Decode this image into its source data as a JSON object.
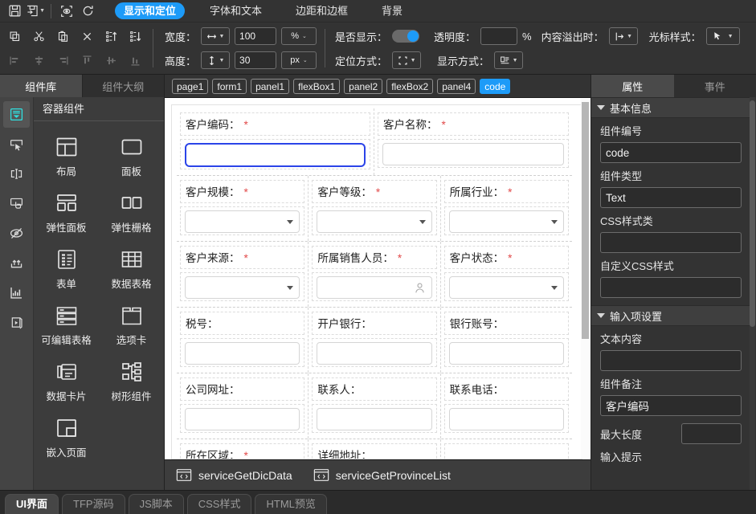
{
  "toolbar": {
    "file_actions": [
      {
        "name": "save-icon",
        "title": "保存"
      },
      {
        "name": "save-as-icon",
        "title": "另存为"
      },
      {
        "name": "preview-icon",
        "title": "预览"
      },
      {
        "name": "refresh-icon",
        "title": "刷新"
      }
    ],
    "category_tabs": [
      {
        "label": "显示和定位",
        "active": true
      },
      {
        "label": "字体和文本",
        "active": false
      },
      {
        "label": "边距和边框",
        "active": false
      },
      {
        "label": "背景",
        "active": false
      }
    ],
    "edit_actions": [
      {
        "name": "copy-icon",
        "disabled": false
      },
      {
        "name": "cut-icon",
        "disabled": false
      },
      {
        "name": "paste-icon",
        "disabled": false
      },
      {
        "name": "delete-icon",
        "disabled": false
      },
      {
        "name": "move-up-icon",
        "disabled": false
      },
      {
        "name": "move-down-icon",
        "disabled": false
      }
    ],
    "align_actions": [
      {
        "name": "align-left-icon",
        "disabled": true
      },
      {
        "name": "align-center-h-icon",
        "disabled": true
      },
      {
        "name": "align-right-icon",
        "disabled": true
      },
      {
        "name": "align-top-icon",
        "disabled": true
      },
      {
        "name": "align-middle-v-icon",
        "disabled": true
      },
      {
        "name": "align-bottom-icon",
        "disabled": true
      }
    ],
    "width_label": "宽度：",
    "width_value": "100",
    "width_unit": "%",
    "height_label": "高度：",
    "height_value": "30",
    "height_unit": "px",
    "visible_label": "是否显示：",
    "visible_on": true,
    "opacity_label": "透明度：",
    "opacity_value": "",
    "opacity_unit": "%",
    "overflow_label": "内容溢出时：",
    "cursor_label": "光标样式：",
    "position_label": "定位方式：",
    "display_label": "显示方式："
  },
  "left_panel": {
    "tabs": [
      {
        "label": "组件库",
        "active": true
      },
      {
        "label": "组件大纲",
        "active": false
      }
    ],
    "rail": [
      {
        "name": "container-icon",
        "active": true
      },
      {
        "name": "selection-icon",
        "active": false
      },
      {
        "name": "input-icon",
        "active": false
      },
      {
        "name": "button-icon",
        "active": false
      },
      {
        "name": "hidden-icon",
        "active": false
      },
      {
        "name": "upload-icon",
        "active": false
      },
      {
        "name": "chart-icon",
        "active": false
      },
      {
        "name": "media-icon",
        "active": false
      }
    ],
    "group_title": "容器组件",
    "components": [
      {
        "label": "布局",
        "icon": "layout-icon"
      },
      {
        "label": "面板",
        "icon": "panel-icon"
      },
      {
        "label": "弹性面板",
        "icon": "flex-panel-icon"
      },
      {
        "label": "弹性栅格",
        "icon": "flex-grid-icon"
      },
      {
        "label": "表单",
        "icon": "form-icon"
      },
      {
        "label": "数据表格",
        "icon": "data-table-icon"
      },
      {
        "label": "可编辑表格",
        "icon": "editable-table-icon"
      },
      {
        "label": "选项卡",
        "icon": "tabs-icon"
      },
      {
        "label": "数据卡片",
        "icon": "data-card-icon"
      },
      {
        "label": "树形组件",
        "icon": "tree-icon"
      },
      {
        "label": "嵌入页面",
        "icon": "iframe-icon"
      }
    ]
  },
  "breadcrumb": [
    {
      "label": "page1",
      "active": false
    },
    {
      "label": "form1",
      "active": false
    },
    {
      "label": "panel1",
      "active": false
    },
    {
      "label": "flexBox1",
      "active": false
    },
    {
      "label": "panel2",
      "active": false
    },
    {
      "label": "flexBox2",
      "active": false
    },
    {
      "label": "panel4",
      "active": false
    },
    {
      "label": "code",
      "active": true
    }
  ],
  "canvas": {
    "rows": [
      {
        "cells": [
          {
            "label": "客户编码：",
            "required": true,
            "control": "text",
            "focused": true,
            "span": 2
          },
          {
            "label": "客户名称：",
            "required": true,
            "control": "text",
            "focused": false,
            "span": 2
          }
        ]
      },
      {
        "cells": [
          {
            "label": "客户规模：",
            "required": true,
            "control": "select",
            "focused": false,
            "span": 1
          },
          {
            "label": "客户等级：",
            "required": true,
            "control": "select",
            "focused": false,
            "span": 1
          },
          {
            "label": "所属行业：",
            "required": true,
            "control": "select",
            "focused": false,
            "span": 1
          }
        ]
      },
      {
        "cells": [
          {
            "label": "客户来源：",
            "required": true,
            "control": "select",
            "focused": false,
            "span": 1
          },
          {
            "label": "所属销售人员：",
            "required": true,
            "control": "person",
            "focused": false,
            "span": 1
          },
          {
            "label": "客户状态：",
            "required": true,
            "control": "select",
            "focused": false,
            "span": 1
          }
        ]
      },
      {
        "cells": [
          {
            "label": "税号：",
            "required": false,
            "control": "text",
            "focused": false,
            "span": 1
          },
          {
            "label": "开户银行：",
            "required": false,
            "control": "text",
            "focused": false,
            "span": 1
          },
          {
            "label": "银行账号：",
            "required": false,
            "control": "text",
            "focused": false,
            "span": 1
          }
        ]
      },
      {
        "cells": [
          {
            "label": "公司网址：",
            "required": false,
            "control": "text",
            "focused": false,
            "span": 1
          },
          {
            "label": "联系人：",
            "required": false,
            "control": "text",
            "focused": false,
            "span": 1
          },
          {
            "label": "联系电话：",
            "required": false,
            "control": "text",
            "focused": false,
            "span": 1
          }
        ]
      },
      {
        "cells": [
          {
            "label": "所在区域：",
            "required": true,
            "control": "none",
            "focused": false,
            "span": 1
          },
          {
            "label": "详细地址：",
            "required": false,
            "control": "none",
            "focused": false,
            "span": 1
          },
          {
            "label": "",
            "required": false,
            "control": "none",
            "focused": false,
            "span": 1
          }
        ]
      }
    ]
  },
  "services": [
    {
      "label": "serviceGetDicData",
      "icon": "code-icon"
    },
    {
      "label": "serviceGetProvinceList",
      "icon": "code-icon"
    }
  ],
  "right_panel": {
    "tabs": [
      {
        "label": "属性",
        "active": true
      },
      {
        "label": "事件",
        "active": false
      }
    ],
    "sections": [
      {
        "title": "基本信息",
        "expanded": true,
        "fields": [
          {
            "key": "组件编号",
            "value": "code",
            "inline": false
          },
          {
            "key": "组件类型",
            "value": "Text",
            "inline": false
          },
          {
            "key": "CSS样式类",
            "value": "",
            "inline": false
          },
          {
            "key": "自定义CSS样式",
            "value": "",
            "inline": false
          }
        ]
      },
      {
        "title": "输入项设置",
        "expanded": true,
        "fields": [
          {
            "key": "文本内容",
            "value": "",
            "inline": false
          },
          {
            "key": "组件备注",
            "value": "客户编码",
            "inline": false
          },
          {
            "key": "最大长度",
            "value": "",
            "inline": true
          },
          {
            "key": "输入提示",
            "value": "",
            "inline": false
          }
        ]
      }
    ]
  },
  "status_tabs": [
    {
      "label": "UI界面",
      "active": true
    },
    {
      "label": "TFP源码",
      "active": false
    },
    {
      "label": "JS脚本",
      "active": false
    },
    {
      "label": "CSS样式",
      "active": false
    },
    {
      "label": "HTML预览",
      "active": false
    }
  ],
  "colors": {
    "accent": "#1d9bf8",
    "focus_outline": "#2b44e8",
    "required": "#e24a4a",
    "rail_active": "#2fe0e0",
    "chrome": "#333333",
    "canvas": "#ffffff"
  }
}
